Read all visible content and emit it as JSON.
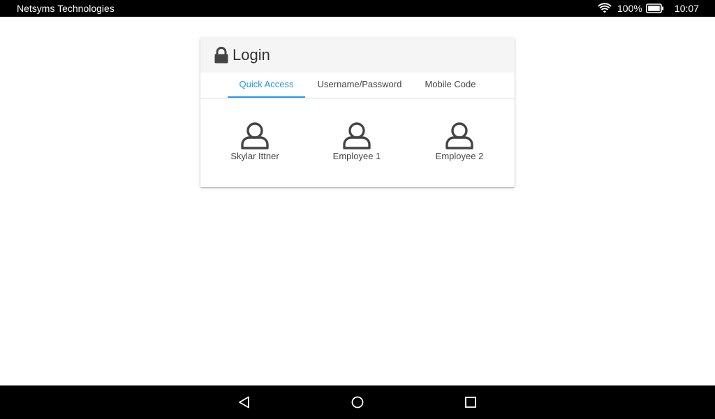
{
  "status_bar": {
    "app_name": "Netsyms Technologies",
    "battery_percent": "100%",
    "time": "10:07",
    "icons": [
      "wifi-icon",
      "battery-icon"
    ]
  },
  "login_card": {
    "title": "Login",
    "title_icon": "lock-icon",
    "tabs": [
      {
        "label": "Quick Access",
        "active": true
      },
      {
        "label": "Username/Password",
        "active": false
      },
      {
        "label": "Mobile Code",
        "active": false
      }
    ],
    "users": [
      {
        "name": "Skylar Ittner",
        "icon": "user-icon"
      },
      {
        "name": "Employee 1",
        "icon": "user-icon"
      },
      {
        "name": "Employee 2",
        "icon": "user-icon"
      }
    ]
  },
  "nav_bar": {
    "buttons": [
      "back-icon",
      "home-icon",
      "recent-apps-icon"
    ]
  },
  "colors": {
    "accent": "#2196f3",
    "status_bar_bg": "#000000",
    "card_header_bg": "#f5f5f5",
    "text": "#444444"
  }
}
